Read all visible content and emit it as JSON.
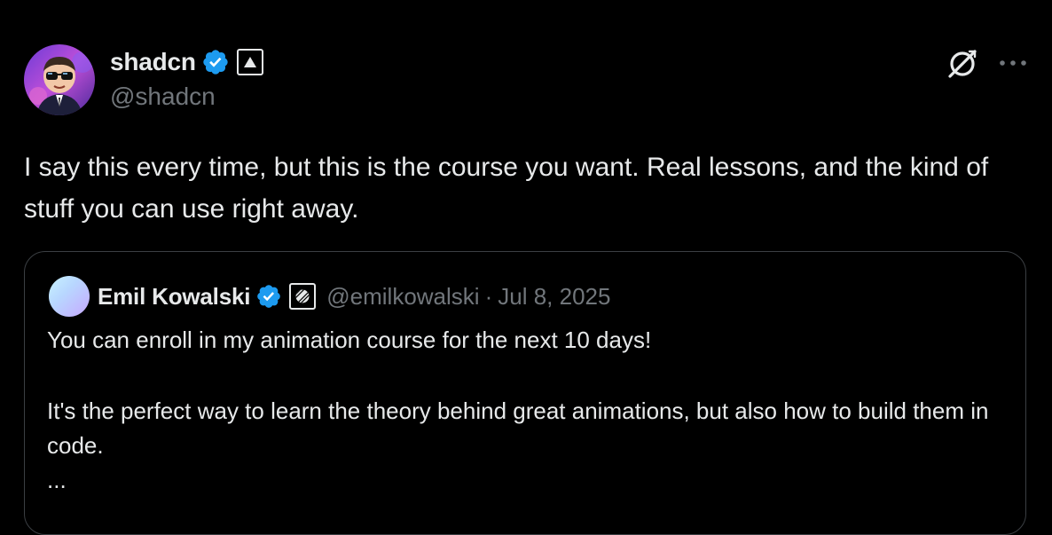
{
  "author": {
    "name": "shadcn",
    "handle": "@shadcn",
    "avatar_icon": "avatar-cartoon-person-sunglasses"
  },
  "icons": {
    "verified": "verified-badge-icon",
    "affiliate": "affiliate-badge-icon",
    "grok": "grok-icon",
    "more": "more-icon"
  },
  "colors": {
    "background": "#000000",
    "text": "#e7e9ea",
    "secondary_text": "#71767b",
    "verified_blue": "#1d9bf0",
    "border": "#3b3f43"
  },
  "tweet": {
    "text": "I say this every time, but this is the course you want. Real lessons, and the kind of stuff you can use right away."
  },
  "quote": {
    "name": "Emil Kowalski",
    "handle": "@emilkowalski",
    "separator": "·",
    "date": "Jul 8, 2025",
    "line1": "You can enroll in my animation course for the next 10 days!",
    "line2": "It's the perfect way to learn the theory behind great animations, but also how to build them in code.",
    "line3": "..."
  }
}
